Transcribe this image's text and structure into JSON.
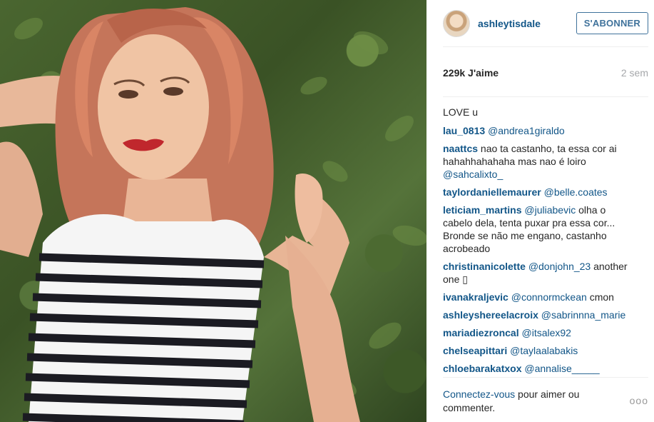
{
  "post": {
    "username": "ashleytisdale",
    "follow_label": "S'ABONNER",
    "likes": "229k J'aime",
    "time_ago": "2 sem",
    "caption": "LOVE u"
  },
  "comments": [
    {
      "user": "lau_0813",
      "mention": "@andrea1giraldo",
      "text": ""
    },
    {
      "user": "naattcs",
      "mention": "",
      "text": "nao ta castanho, ta essa cor ai hahahhahahaha mas nao é loiro",
      "mention_after": "@sahcalixto_"
    },
    {
      "user": "taylordaniellemaurer",
      "mention": "@belle.coates",
      "text": ""
    },
    {
      "user": "leticiam_martins",
      "mention": "@juliabevic",
      "text": "olha o cabelo dela, tenta puxar pra essa cor... Bronde se não me engano, castanho acrobeado"
    },
    {
      "user": "christinanicolette",
      "mention": "@donjohn_23",
      "text": "another one ▯"
    },
    {
      "user": "ivanakraljevic",
      "mention": "@connormckean",
      "text": "cmon"
    },
    {
      "user": "ashleyshereelacroix",
      "mention": "@sabrinnna_marie",
      "text": ""
    },
    {
      "user": "mariadiezroncal",
      "mention": "@itsalex92",
      "text": ""
    },
    {
      "user": "chelseapittari",
      "mention": "@taylaalabakis",
      "text": ""
    },
    {
      "user": "chloebarakatxox",
      "mention": "@annalise_____",
      "text": ""
    }
  ],
  "footer": {
    "login_link": "Connectez-vous",
    "login_text": " pour aimer ou commenter.",
    "more_icon": "ellipsis-icon",
    "more_glyph": "ooo"
  },
  "colors": {
    "link": "#125688",
    "follow": "#3f729b",
    "muted": "#a5a7aa"
  }
}
